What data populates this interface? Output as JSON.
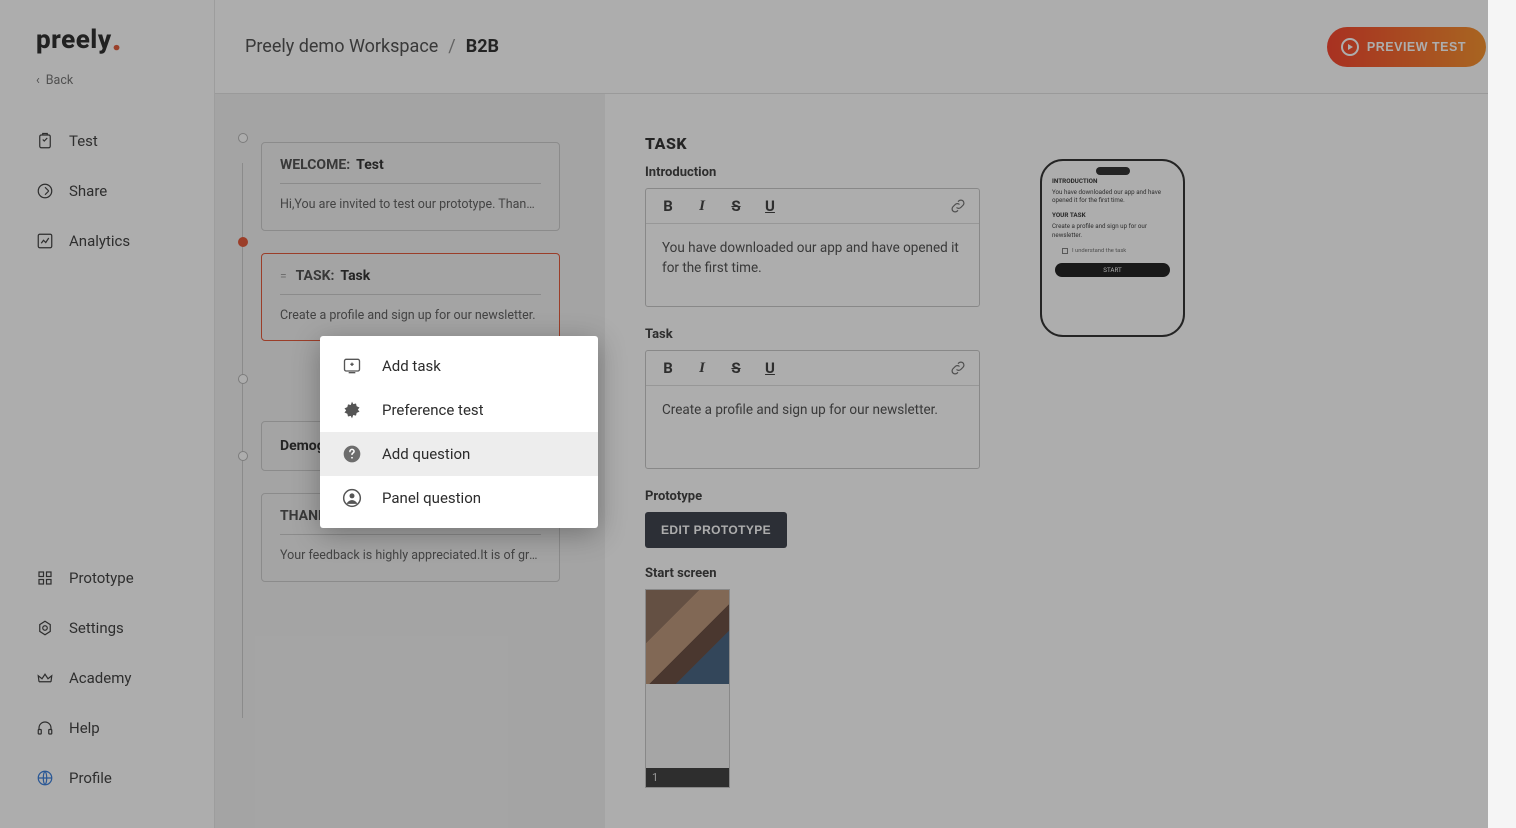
{
  "brand": "preely",
  "back_label": "Back",
  "nav": {
    "top": [
      "Test",
      "Share",
      "Analytics"
    ],
    "bottom": [
      "Prototype",
      "Settings",
      "Academy",
      "Help",
      "Profile"
    ]
  },
  "breadcrumb": {
    "workspace": "Preely demo Workspace",
    "sep": "/",
    "project": "B2B"
  },
  "preview_btn": "PREVIEW TEST",
  "steps": [
    {
      "type": "WELCOME:",
      "title": "Test",
      "body": "Hi,You are invited to test our prototype. Thank …"
    },
    {
      "type": "TASK:",
      "title": "Task",
      "body": "Create a profile and sign up for our newsletter.",
      "active": true,
      "drag": true
    },
    {
      "simple": true,
      "title": "Demogr"
    },
    {
      "type": "THANK",
      "title": "",
      "body": "Your feedback is highly appreciated.It is of gre…"
    }
  ],
  "editor": {
    "section": "TASK",
    "intro_label": "Introduction",
    "intro_text": "You have downloaded our app and have opened it for the first time.",
    "task_label": "Task",
    "task_text": "Create a profile and sign up for our newsletter.",
    "proto_label": "Prototype",
    "edit_proto_btn": "EDIT PROTOTYPE",
    "start_label": "Start screen",
    "thumb_num": "1"
  },
  "phone": {
    "h1": "INTRODUCTION",
    "p1": "You have downloaded our app and have opened it for the first time.",
    "h2": "YOUR TASK",
    "p2": "Create a profile and sign up for our newsletter.",
    "check": "I understand the task",
    "btn": "START"
  },
  "menu": {
    "items": [
      {
        "label": "Add task",
        "icon": "task-icon"
      },
      {
        "label": "Preference test",
        "icon": "gear-icon"
      },
      {
        "label": "Add question",
        "icon": "question-icon",
        "hover": true
      },
      {
        "label": "Panel question",
        "icon": "person-icon"
      }
    ]
  }
}
